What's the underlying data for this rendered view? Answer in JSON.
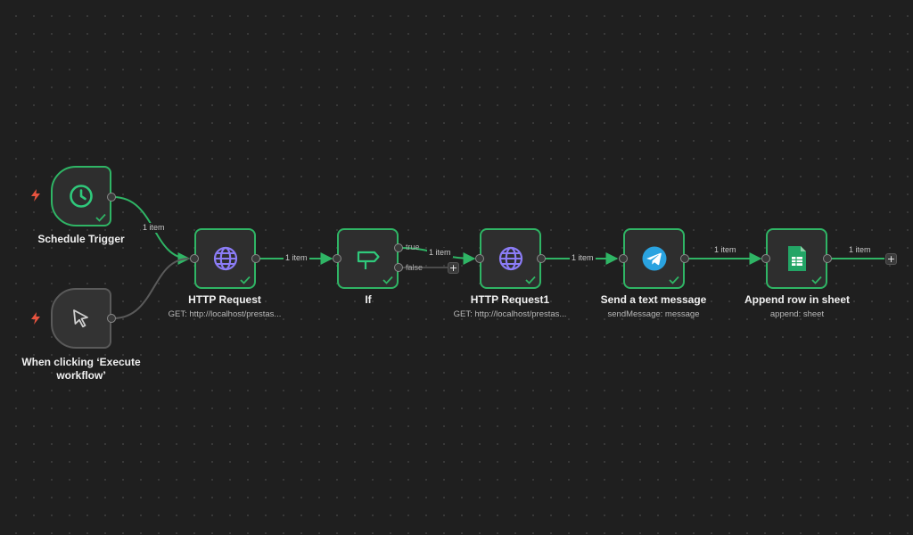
{
  "nodes": {
    "schedule_trigger": {
      "title": "Schedule Trigger",
      "icon": "clock-icon",
      "status": "success"
    },
    "manual_trigger": {
      "title": "When clicking ‘Execute workflow’",
      "title_line1": "When clicking ‘Execute",
      "title_line2": "workflow’",
      "icon": "cursor-icon"
    },
    "http_request": {
      "title": "HTTP Request",
      "subtitle": "GET: http://localhost/prestas...",
      "icon": "globe-icon",
      "status": "success"
    },
    "if": {
      "title": "If",
      "icon": "signpost-icon",
      "status": "success",
      "true_label": "true",
      "false_label": "false"
    },
    "http_request1": {
      "title": "HTTP Request1",
      "subtitle": "GET: http://localhost/prestas...",
      "icon": "globe-icon",
      "status": "success"
    },
    "telegram": {
      "title": "Send a text message",
      "subtitle": "sendMessage: message",
      "icon": "telegram-icon",
      "status": "success"
    },
    "sheets": {
      "title": "Append row in sheet",
      "subtitle": "append: sheet",
      "icon": "google-sheets-icon",
      "status": "success"
    }
  },
  "edges": {
    "schedule_to_http": "1 item",
    "http_to_if": "1 item",
    "if_true_to_http1": "1 item",
    "http1_to_telegram": "1 item",
    "telegram_to_sheets": "1 item",
    "sheets_output": "1 item"
  },
  "colors": {
    "canvas": "#1f1f1f",
    "success": "#2fb565",
    "trigger_bolt": "#e8533f",
    "globe": "#8b7cf6",
    "telegram": "#2aa3e0",
    "sheets": "#23a566"
  }
}
